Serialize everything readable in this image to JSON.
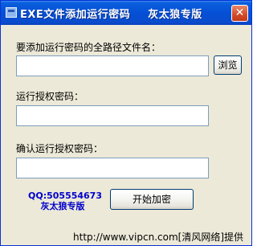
{
  "window": {
    "title_left": "EXE文件添加运行密码",
    "title_right": "灰太狼专版",
    "close_symbol": "✕"
  },
  "fields": {
    "path_label": "要添加运行密码的全路径文件名：",
    "path_value": "",
    "browse_label": "浏览",
    "password_label": "运行授权密码：",
    "password_value": "",
    "confirm_label": "确认运行授权密码：",
    "confirm_value": ""
  },
  "footer": {
    "qq_line1": "QQ:505554673",
    "qq_line2": "灰太狼专版",
    "start_label": "开始加密",
    "watermark": "http://www.vipcn.com[清风网络]提供"
  },
  "colors": {
    "titlebar": "#0550d6",
    "window_bg": "#ece9d8",
    "qq_text": "#0000cc"
  }
}
